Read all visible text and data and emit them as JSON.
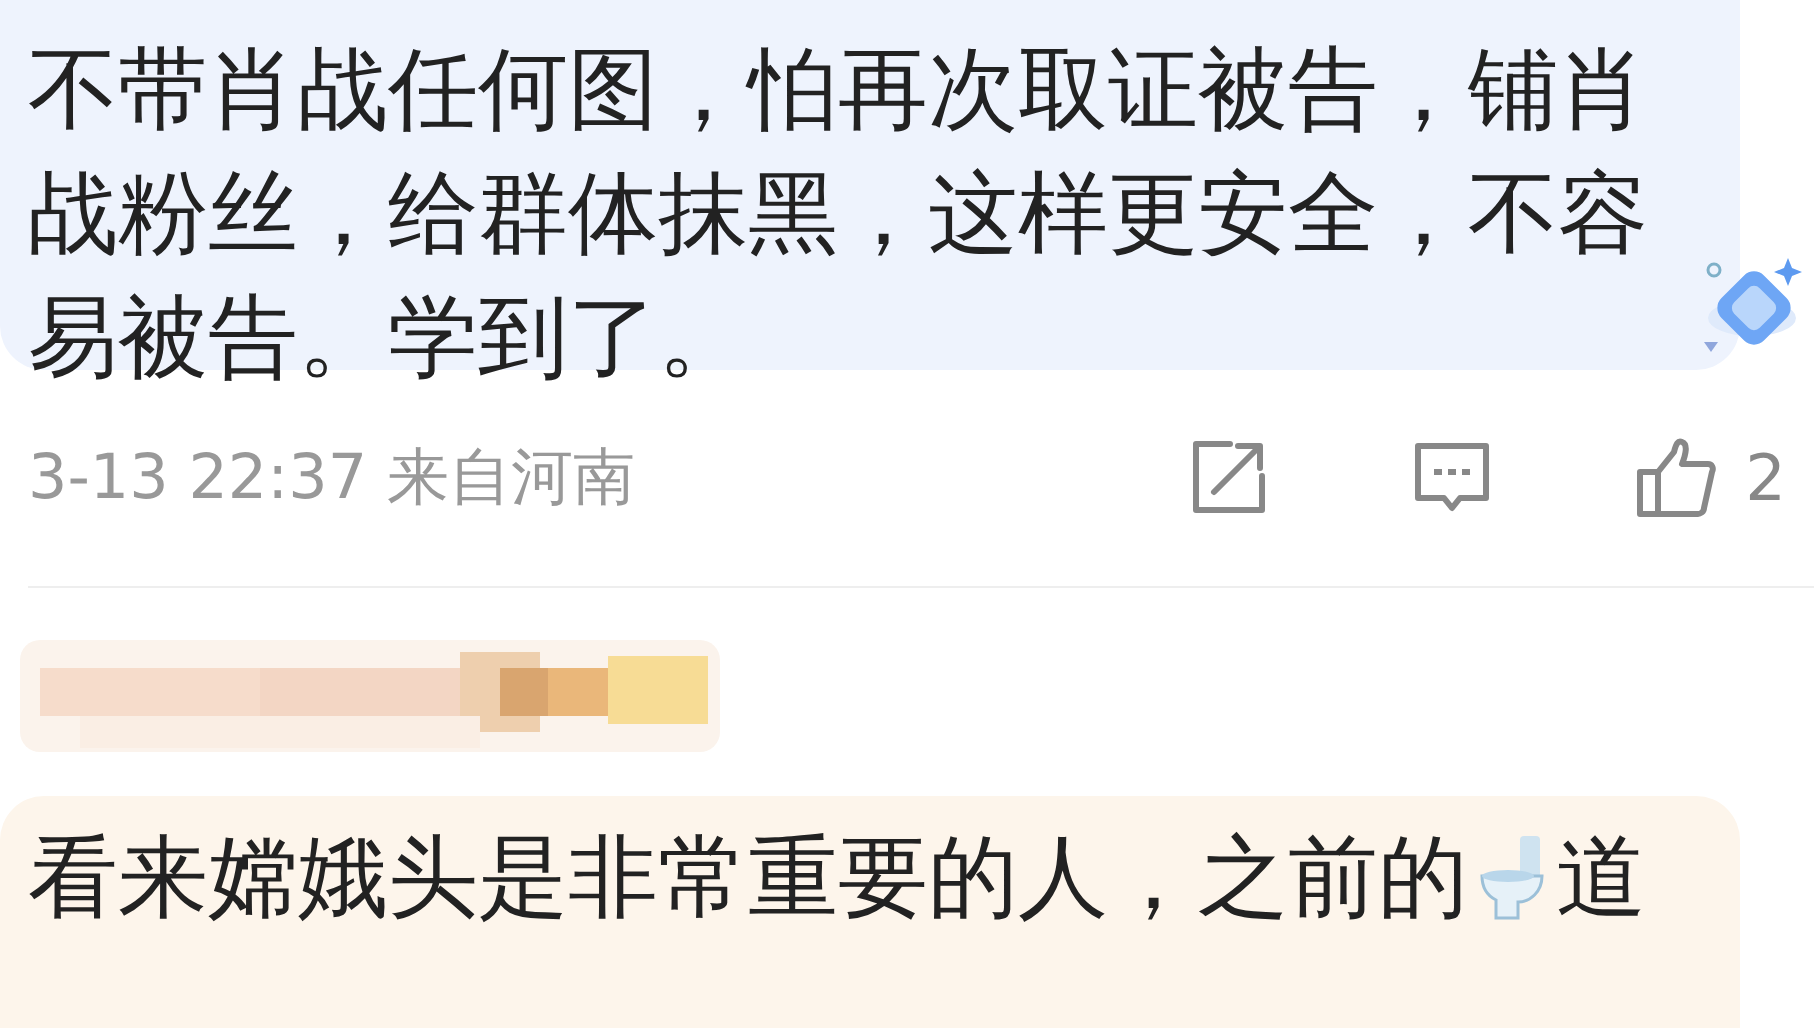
{
  "comments": [
    {
      "text": "不带肖战任何图，怕再次取证被告，铺肖战粉丝，给群体抹黑，这样更安全，不容易被告。学到了。",
      "color": "#eef3fd",
      "time": "3-13 22:37 来自河南",
      "likes": "2"
    },
    {
      "text_before_emoji": "看来嫦娥头是非常重要的人，之前的",
      "text_after_emoji": "道",
      "color": "#fdf5eb"
    }
  ]
}
